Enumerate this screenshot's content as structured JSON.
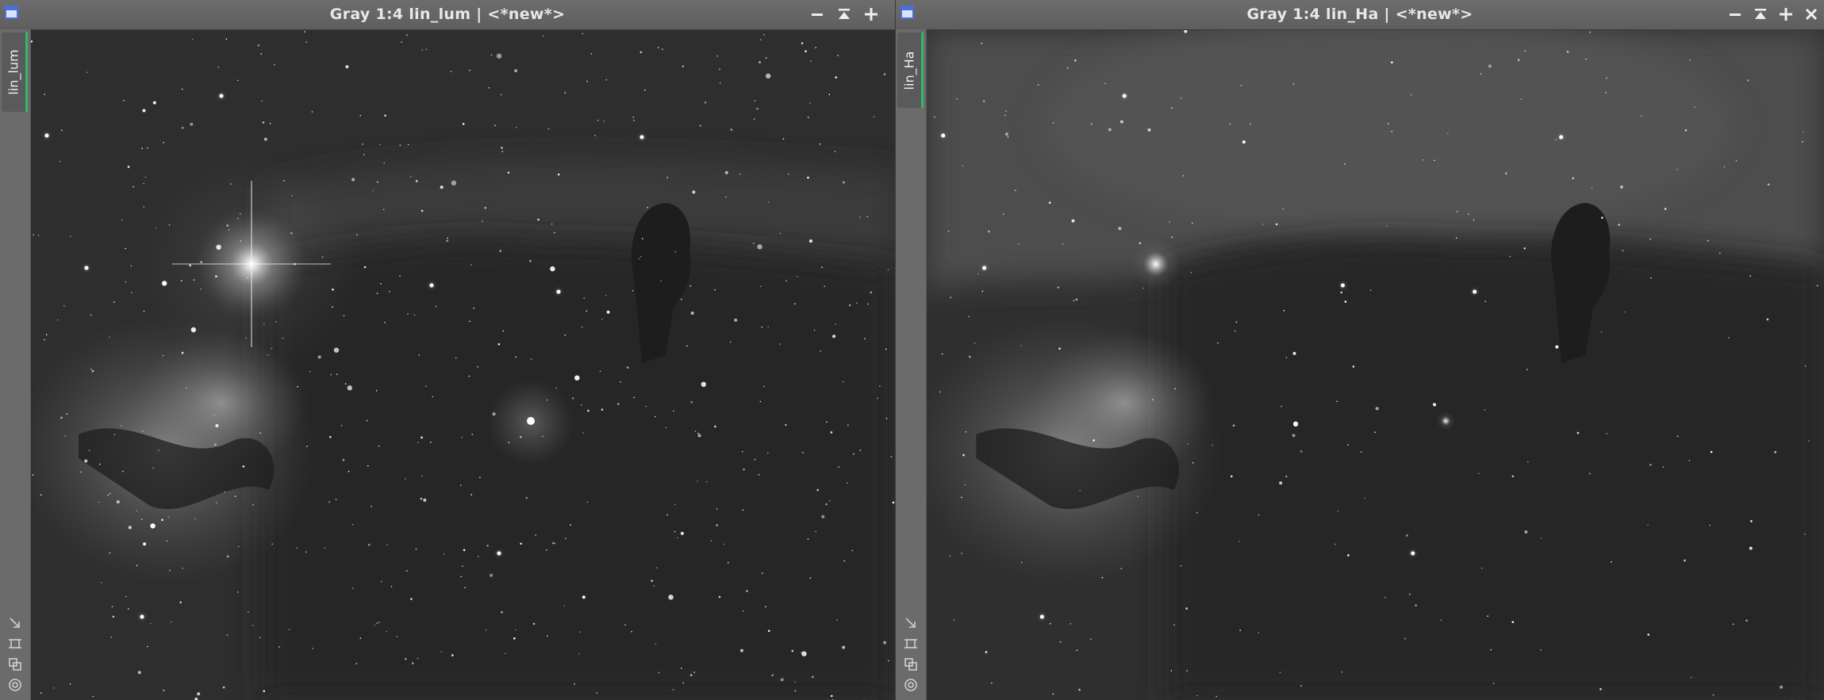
{
  "windows": [
    {
      "id": "lum",
      "title": "Gray 1:4 lin_lum | <*new*>",
      "tab_label": "lin_lum",
      "image_subject": "Horsehead and Flame nebula, luminance"
    },
    {
      "id": "ha",
      "title": "Gray 1:4 lin_Ha | <*new*>",
      "tab_label": "lin_Ha",
      "image_subject": "Horsehead and Flame nebula, hydrogen-alpha"
    }
  ],
  "icons": {
    "window_icon": "window-icon",
    "minimize": "minimize-icon",
    "shade": "shade-icon",
    "maximize": "maximize-icon",
    "close": "close-icon",
    "tool1": "resize-arrow-icon",
    "tool2": "crop-icon",
    "tool3": "clone-icon",
    "tool4": "target-icon"
  },
  "colors": {
    "titlebar": "#636363",
    "tab_accent": "#2dbb6b",
    "window_icon": "#4c6fd6"
  }
}
